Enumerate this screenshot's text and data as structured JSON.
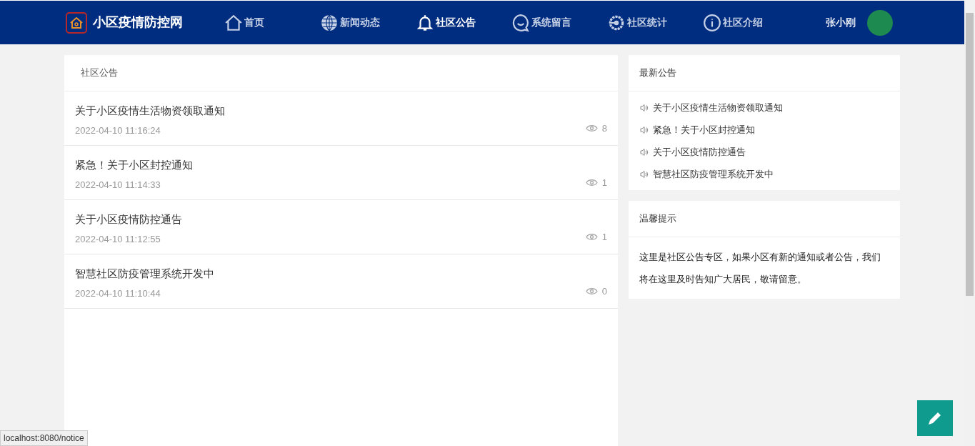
{
  "header": {
    "logo": "小区疫情防控网",
    "nav": [
      {
        "label": "首页",
        "kind": "house",
        "selected": false
      },
      {
        "label": "新闻动态",
        "kind": "globe",
        "selected": false
      },
      {
        "label": "社区公告",
        "kind": "bell",
        "selected": true
      },
      {
        "label": "系统留言",
        "kind": "chat",
        "selected": false
      },
      {
        "label": "社区统计",
        "kind": "gear",
        "selected": false
      },
      {
        "label": "社区介绍",
        "kind": "info",
        "selected": false
      }
    ],
    "user": "张小刚"
  },
  "notice_list": {
    "title": "社区公告",
    "items": [
      {
        "title": "关于小区疫情生活物资领取通知",
        "time": "2022-04-10 11:16:24",
        "views": "8"
      },
      {
        "title": "紧急！关于小区封控通知",
        "time": "2022-04-10 11:14:33",
        "views": "1"
      },
      {
        "title": "关于小区疫情防控通告",
        "time": "2022-04-10 11:12:55",
        "views": "1"
      },
      {
        "title": "智慧社区防疫管理系统开发中",
        "time": "2022-04-10 11:10:44",
        "views": "0"
      }
    ]
  },
  "latest": {
    "title": "最新公告",
    "items": [
      "关于小区疫情生活物资领取通知",
      "紧急！关于小区封控通知",
      "关于小区疫情防控通告",
      "智慧社区防疫管理系统开发中"
    ]
  },
  "tips": {
    "title": "温馨提示",
    "text": "这里是社区公告专区，如果小区有新的通知或者公告，我们将在这里及时告知广大居民，敬请留意。"
  },
  "status_bar": "localhost:8080/notice"
}
